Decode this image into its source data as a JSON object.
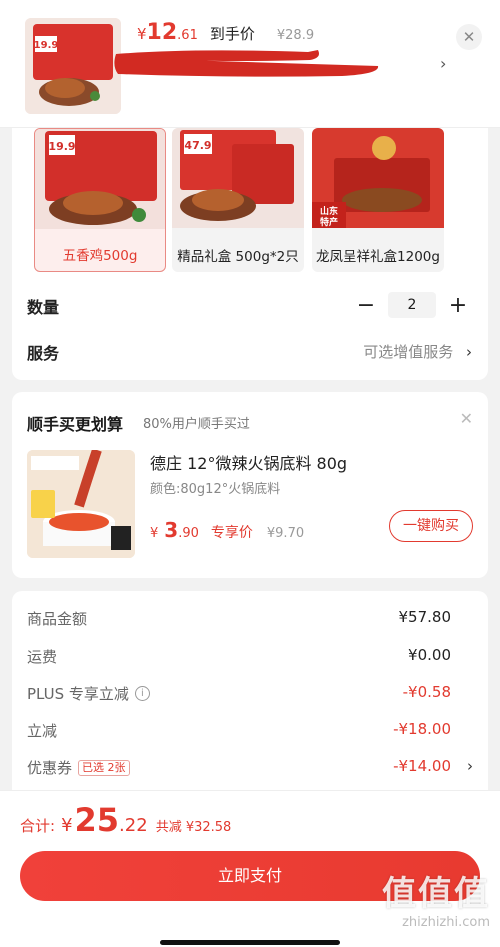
{
  "topbar": {
    "currency": "¥",
    "price_int": "12",
    "price_dec": ".61",
    "price_label": "到手价",
    "orig_price": "¥28.9",
    "close_glyph": "✕",
    "chevron_glyph": "›",
    "thumb_badge": "19.9"
  },
  "options": [
    {
      "label": "五香鸡500g",
      "badge": "19.9",
      "selected": true
    },
    {
      "label": "精品礼盒 500g*2只",
      "badge": "47.9",
      "selected": false
    },
    {
      "label": "龙凤呈祥礼盒1200g",
      "badge": "山东特产",
      "selected": false
    }
  ],
  "quantity": {
    "label": "数量",
    "minus": "−",
    "value": "2",
    "plus": "+"
  },
  "service": {
    "label": "服务",
    "value": "可选增值服务",
    "chevron": "›"
  },
  "addon": {
    "title": "顺手买更划算",
    "subtitle": "80%用户顺手买过",
    "close_glyph": "✕",
    "name": "德庄 12°微辣火锅底料 80g",
    "spec": "颜色:80g12°火锅底料",
    "currency": "¥",
    "price_int": "3",
    "price_dec": ".90",
    "price_label": "专享价",
    "orig_price": "¥9.70",
    "buy_label": "一键购买"
  },
  "summary": [
    {
      "key": "商品金额",
      "value": "¥57.80",
      "red": false
    },
    {
      "key": "运费",
      "value": "¥0.00",
      "red": false
    },
    {
      "key": "PLUS 专享立减",
      "value": "-¥0.58",
      "red": true,
      "info": "i"
    },
    {
      "key": "立减",
      "value": "-¥18.00",
      "red": true
    },
    {
      "key": "优惠券",
      "value": "-¥14.00",
      "red": true,
      "tag": "已选 2张",
      "chevron": "›"
    }
  ],
  "total": {
    "label": "合计:",
    "currency": "¥",
    "int": "25",
    "dec": ".22",
    "save": "共减 ¥32.58"
  },
  "pay_label": "立即支付",
  "watermark": {
    "logo": "值值值",
    "url": "zhizhizhi.com"
  },
  "colors": {
    "accent": "#e23a2f",
    "bg": "#f2f2f2"
  }
}
